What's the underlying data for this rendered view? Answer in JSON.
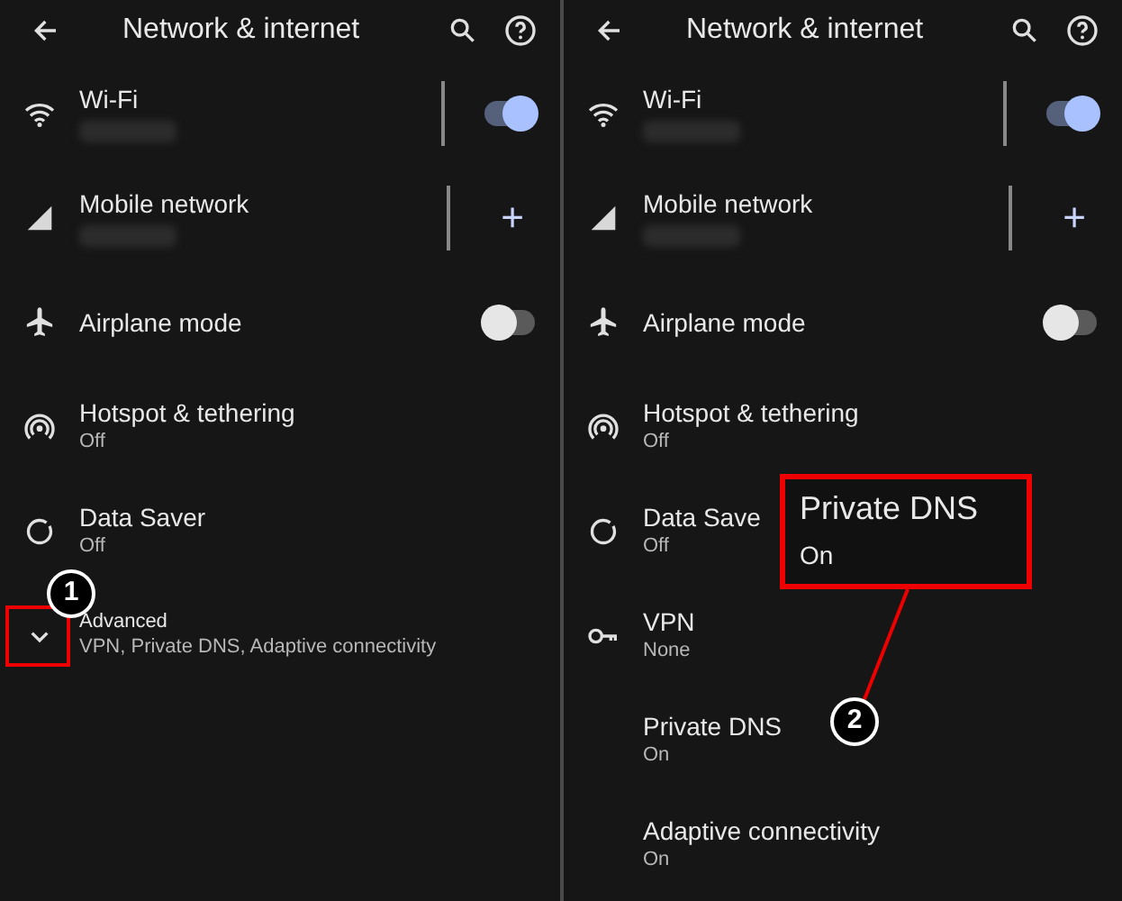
{
  "panels": [
    {
      "header": {
        "title": "Network & internet"
      },
      "items": [
        {
          "kind": "wifi",
          "title": "Wi-Fi",
          "subtitle_redacted": true,
          "control": {
            "kind": "toggle",
            "on": true
          },
          "split": true
        },
        {
          "kind": "signal",
          "title": "Mobile network",
          "subtitle_redacted": true,
          "control": {
            "kind": "plus",
            "label": "+"
          },
          "split": true
        },
        {
          "kind": "airplane",
          "title": "Airplane mode",
          "control": {
            "kind": "toggle",
            "on": false
          }
        },
        {
          "kind": "hotspot",
          "title": "Hotspot & tethering",
          "subtitle": "Off"
        },
        {
          "kind": "datasaver",
          "title": "Data Saver",
          "subtitle": "Off"
        },
        {
          "kind": "advanced",
          "title": "Advanced",
          "subtitle": "VPN, Private DNS, Adaptive connectivity",
          "marker": {
            "number": "1"
          }
        }
      ]
    },
    {
      "header": {
        "title": "Network & internet"
      },
      "items": [
        {
          "kind": "wifi",
          "title": "Wi-Fi",
          "subtitle_redacted": true,
          "control": {
            "kind": "toggle",
            "on": true
          },
          "split": true
        },
        {
          "kind": "signal",
          "title": "Mobile network",
          "subtitle_redacted": true,
          "control": {
            "kind": "plus",
            "label": "+"
          },
          "split": true
        },
        {
          "kind": "airplane",
          "title": "Airplane mode",
          "control": {
            "kind": "toggle",
            "on": false
          }
        },
        {
          "kind": "hotspot",
          "title": "Hotspot & tethering",
          "subtitle": "Off"
        },
        {
          "kind": "datasaver",
          "title": "Data Save",
          "subtitle": "Off"
        },
        {
          "kind": "vpn",
          "title": "VPN",
          "subtitle": "None"
        },
        {
          "kind": "blank",
          "title": "Private DNS",
          "subtitle": "On",
          "callout": {
            "title": "Private DNS",
            "subtitle": "On",
            "number": "2"
          }
        },
        {
          "kind": "blank",
          "title": "Adaptive connectivity",
          "subtitle": "On"
        }
      ]
    }
  ]
}
